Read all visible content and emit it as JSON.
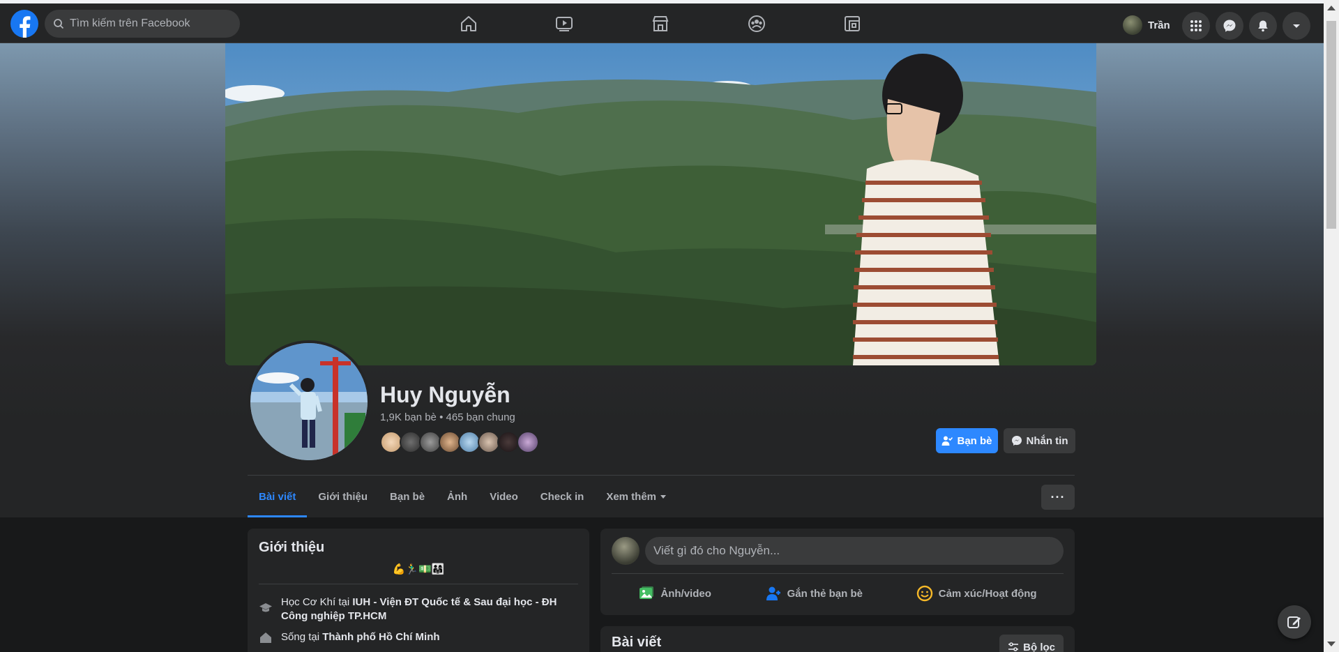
{
  "search": {
    "placeholder": "Tìm kiếm trên Facebook"
  },
  "nav": {
    "icons": [
      "home-icon",
      "watch-icon",
      "marketplace-icon",
      "groups-icon",
      "gaming-icon"
    ]
  },
  "account": {
    "name": "Trần"
  },
  "profile": {
    "name": "Huy Nguyễn",
    "friends_summary": "1,9K bạn bè • 465 bạn chung",
    "friend_button": "Bạn bè",
    "message_button": "Nhắn tin"
  },
  "tabs": [
    "Bài viết",
    "Giới thiệu",
    "Bạn bè",
    "Ảnh",
    "Video",
    "Check in",
    "Xem thêm"
  ],
  "intro": {
    "title": "Giới thiệu",
    "bio": "💪🏃‍♂️💵👨‍👩‍👧",
    "education_prefix": "Học Cơ Khí tại ",
    "education_school": "IUH - Viện ĐT Quốc tế & Sau đại học - ĐH Công nghiệp TP.HCM",
    "lives_prefix": "Sống tại ",
    "lives_city": "Thành phố Hồ Chí Minh"
  },
  "composer": {
    "placeholder": "Viết gì đó cho Nguyễn...",
    "photo_label": "Ảnh/video",
    "tag_label": "Gắn thẻ bạn bè",
    "feeling_label": "Cảm xúc/Hoạt động"
  },
  "posts": {
    "title": "Bài viết",
    "filter_label": "Bộ lọc"
  },
  "colors": {
    "accent": "#2d88ff",
    "background": "#18191a",
    "card": "#242526"
  }
}
